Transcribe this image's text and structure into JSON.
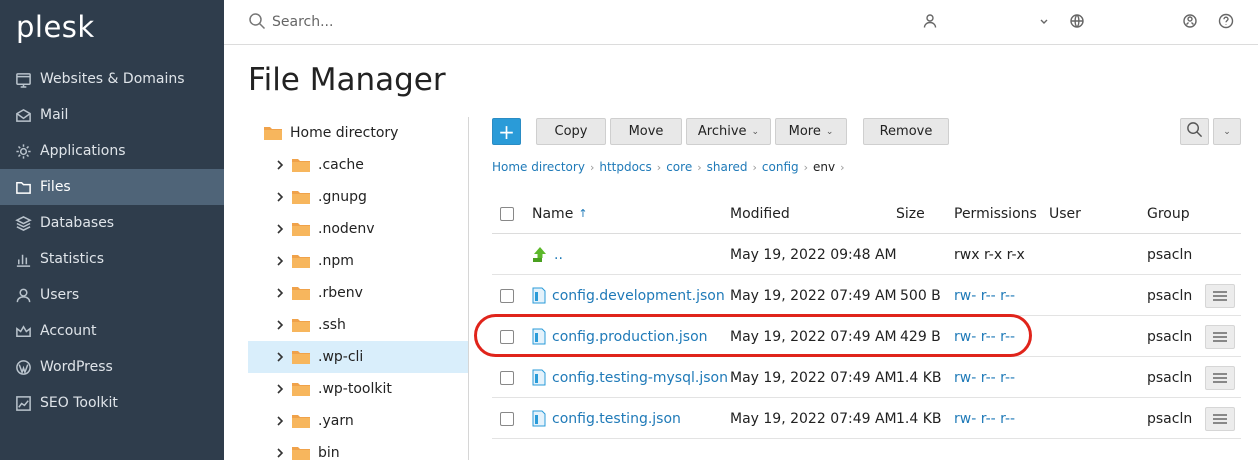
{
  "brand": {
    "logo_text": "plesk",
    "accent": "#4ea5dc"
  },
  "sidebar": {
    "items": [
      {
        "label": "Websites & Domains",
        "icon": "globe-icon",
        "active": false
      },
      {
        "label": "Mail",
        "icon": "mail-icon",
        "active": false
      },
      {
        "label": "Applications",
        "icon": "gear-icon",
        "active": false
      },
      {
        "label": "Files",
        "icon": "folder-icon",
        "active": true
      },
      {
        "label": "Databases",
        "icon": "database-icon",
        "active": false
      },
      {
        "label": "Statistics",
        "icon": "bar-chart-icon",
        "active": false
      },
      {
        "label": "Users",
        "icon": "user-icon",
        "active": false
      },
      {
        "label": "Account",
        "icon": "crown-icon",
        "active": false
      },
      {
        "label": "WordPress",
        "icon": "wordpress-icon",
        "active": false
      },
      {
        "label": "SEO Toolkit",
        "icon": "seo-chart-icon",
        "active": false
      }
    ]
  },
  "topbar": {
    "search_placeholder": "Search..."
  },
  "page": {
    "title": "File Manager"
  },
  "tree": {
    "root": "Home directory",
    "children": [
      ".cache",
      ".gnupg",
      ".nodenv",
      ".npm",
      ".rbenv",
      ".ssh",
      ".wp-cli",
      ".wp-toolkit",
      ".yarn",
      "bin"
    ],
    "selected": ".wp-cli"
  },
  "toolbar": {
    "add_label": "+",
    "copy_label": "Copy",
    "move_label": "Move",
    "archive_label": "Archive",
    "more_label": "More",
    "remove_label": "Remove"
  },
  "breadcrumb": {
    "crumbs": [
      "Home directory",
      "httpdocs",
      "core",
      "shared",
      "config"
    ],
    "current": "env"
  },
  "table": {
    "headers": {
      "name": "Name",
      "modified": "Modified",
      "size": "Size",
      "permissions": "Permissions",
      "user": "User",
      "group": "Group"
    },
    "rows": [
      {
        "name": "..",
        "modified": "May 19, 2022 09:48 AM",
        "size": "",
        "permissions": "rwx r-x r-x",
        "user": "",
        "group": "psacln"
      },
      {
        "name": "config.development.json",
        "modified": "May 19, 2022 07:49 AM",
        "size": "500 B",
        "permissions": "rw- r-- r--",
        "user": "",
        "group": "psacln"
      },
      {
        "name": "config.production.json",
        "modified": "May 19, 2022 07:49 AM",
        "size": "429 B",
        "permissions": "rw- r-- r--",
        "user": "",
        "group": "psacln"
      },
      {
        "name": "config.testing-mysql.json",
        "modified": "May 19, 2022 07:49 AM",
        "size": "1.4 KB",
        "permissions": "rw- r-- r--",
        "user": "",
        "group": "psacln"
      },
      {
        "name": "config.testing.json",
        "modified": "May 19, 2022 07:49 AM",
        "size": "1.4 KB",
        "permissions": "rw- r-- r--",
        "user": "",
        "group": "psacln"
      }
    ]
  },
  "colors": {
    "sidebar_bg": "#2f3d4c",
    "link": "#1f7ab8",
    "highlight": "#e0241b",
    "add_button": "#2a9bd8"
  }
}
